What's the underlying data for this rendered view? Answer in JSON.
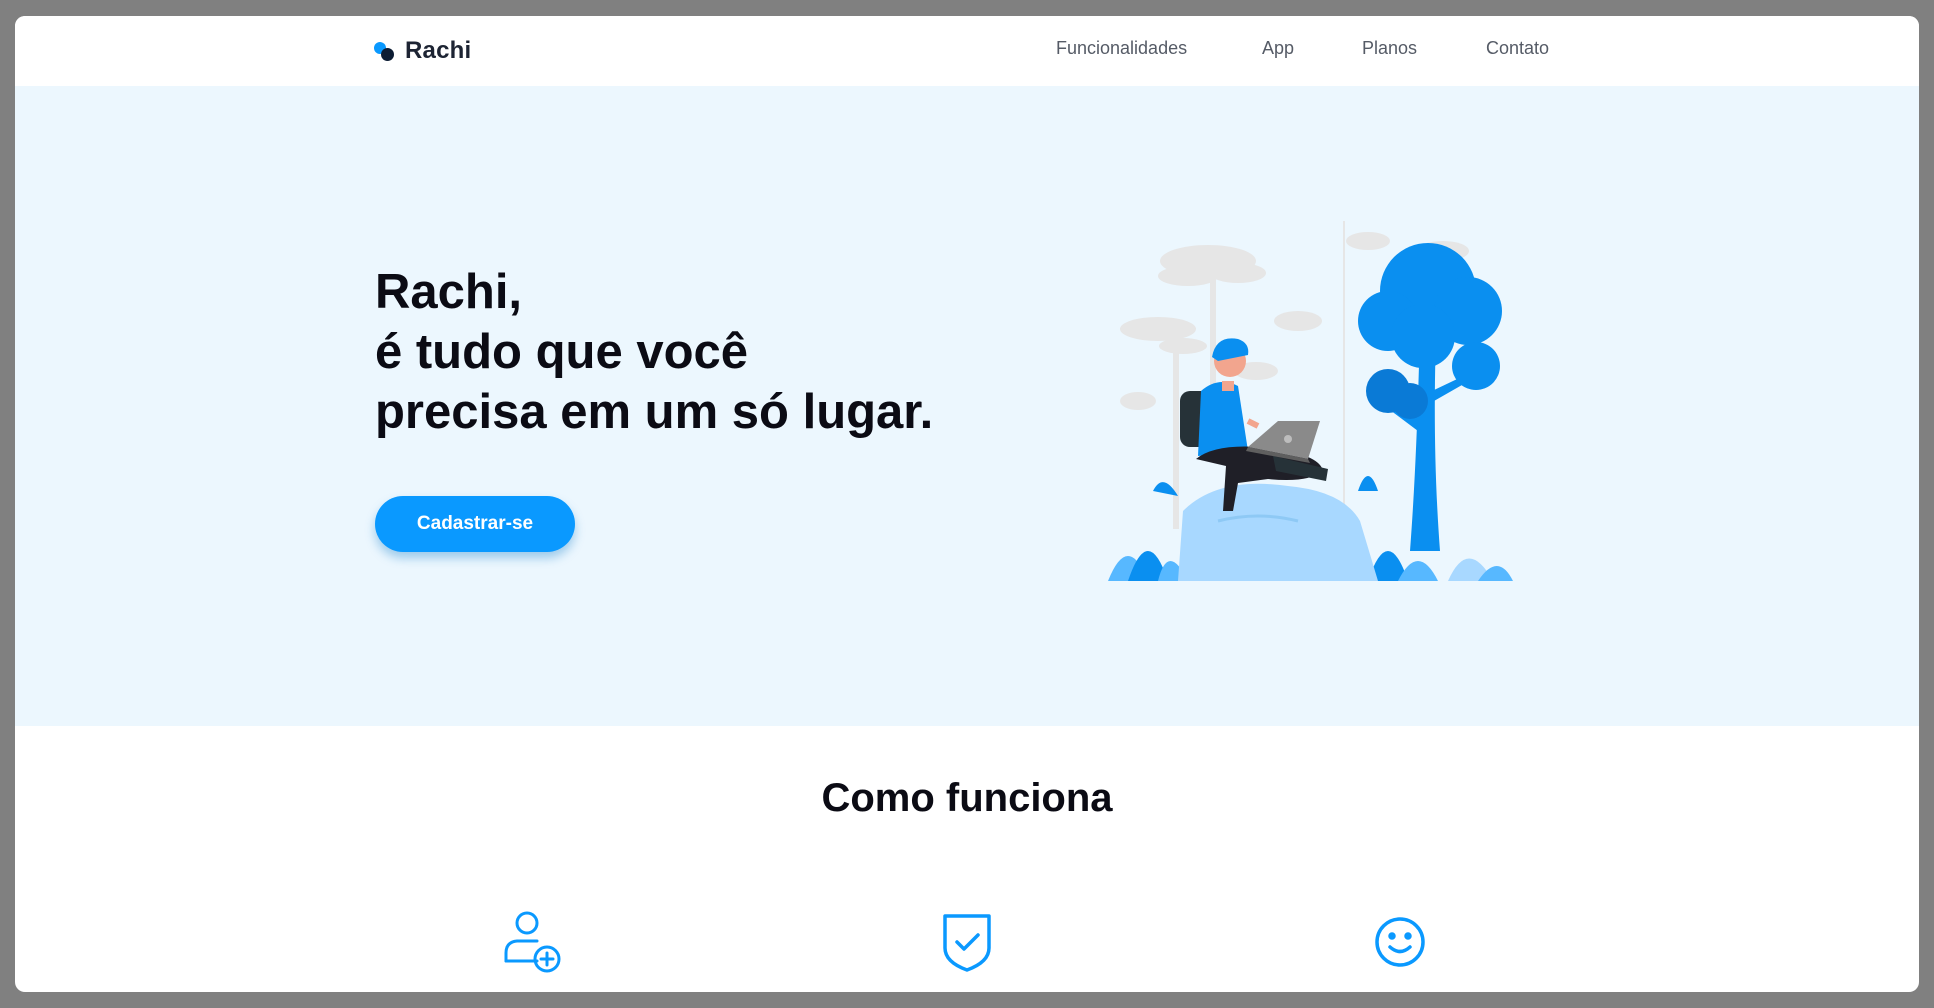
{
  "brand": {
    "name": "Rachi",
    "colors": {
      "primary": "#0a99ff",
      "dark": "#0c1c33"
    }
  },
  "nav": {
    "links": [
      "Funcionalidades",
      "App",
      "Planos",
      "Contato"
    ]
  },
  "hero": {
    "title_lines": [
      "Rachi,",
      "é tudo que você",
      "precisa em um só lugar."
    ],
    "cta_label": "Cadastrar-se",
    "background": "#ecf7fe",
    "illustration": "person-with-laptop-in-forest-illustration"
  },
  "how_it_works": {
    "title": "Como funciona",
    "icons": [
      "user-add-icon",
      "shield-check-icon",
      "smile-icon"
    ]
  }
}
